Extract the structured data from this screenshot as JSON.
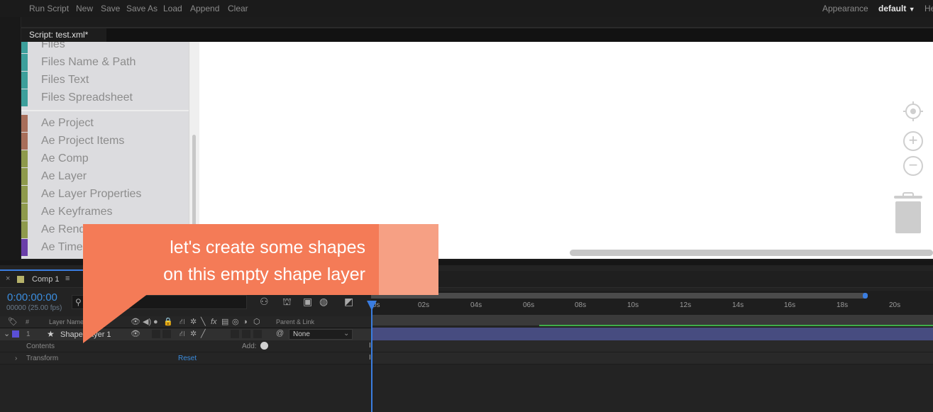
{
  "toolbar": {
    "items": [
      "Run Script",
      "New",
      "Save",
      "Save As",
      "Load",
      "Append",
      "Clear"
    ],
    "appearance_label": "Appearance",
    "appearance_value": "default",
    "help_partial": "He"
  },
  "script_tab": {
    "label": "Script: test.xml*"
  },
  "categories": [
    {
      "label": "Files",
      "color": "#3c9f9b"
    },
    {
      "label": "Files Name & Path",
      "color": "#3c9f9b"
    },
    {
      "label": "Files Text",
      "color": "#3c9f9b"
    },
    {
      "label": "Files Spreadsheet",
      "color": "#3c9f9b"
    },
    {
      "label": "Ae Project",
      "color": "#a86e5a"
    },
    {
      "label": "Ae Project Items",
      "color": "#a86e5a"
    },
    {
      "label": "Ae Comp",
      "color": "#8e9a4c"
    },
    {
      "label": "Ae Layer",
      "color": "#8e9a4c"
    },
    {
      "label": "Ae Layer Properties",
      "color": "#8e9a4c"
    },
    {
      "label": "Ae Keyframes",
      "color": "#8e9a4c"
    },
    {
      "label": "Ae Rend",
      "color": "#8e9a4c"
    },
    {
      "label": "Ae Time",
      "color": "#6a3fa8"
    }
  ],
  "canvas_controls": {
    "center_icon": "crosshair-target-icon",
    "zoom_in": "+",
    "zoom_out": "−",
    "trash_icon": "trash-icon"
  },
  "callout": {
    "line1": "let's create some shapes",
    "line2": "on this empty shape layer",
    "color": "#f47b57"
  },
  "timeline": {
    "comp_tab": "Comp 1",
    "comp_color": "#b6b26a",
    "timecode": "0:00:00:00",
    "fps": "00000 (25.00 fps)",
    "ticks": [
      "0s",
      "02s",
      "04s",
      "06s",
      "08s",
      "10s",
      "12s",
      "14s",
      "16s",
      "18s",
      "20s"
    ],
    "header": {
      "num": "#",
      "layer_name": "Layer Name",
      "parent": "Parent & Link"
    },
    "layer": {
      "number": "1",
      "name": "Shape Layer 1",
      "color": "#5a4fd6",
      "parent": "None"
    },
    "contents_label": "Contents",
    "add_label": "Add:",
    "transform_label": "Transform",
    "reset_label": "Reset",
    "accent": "#3a7de0"
  }
}
